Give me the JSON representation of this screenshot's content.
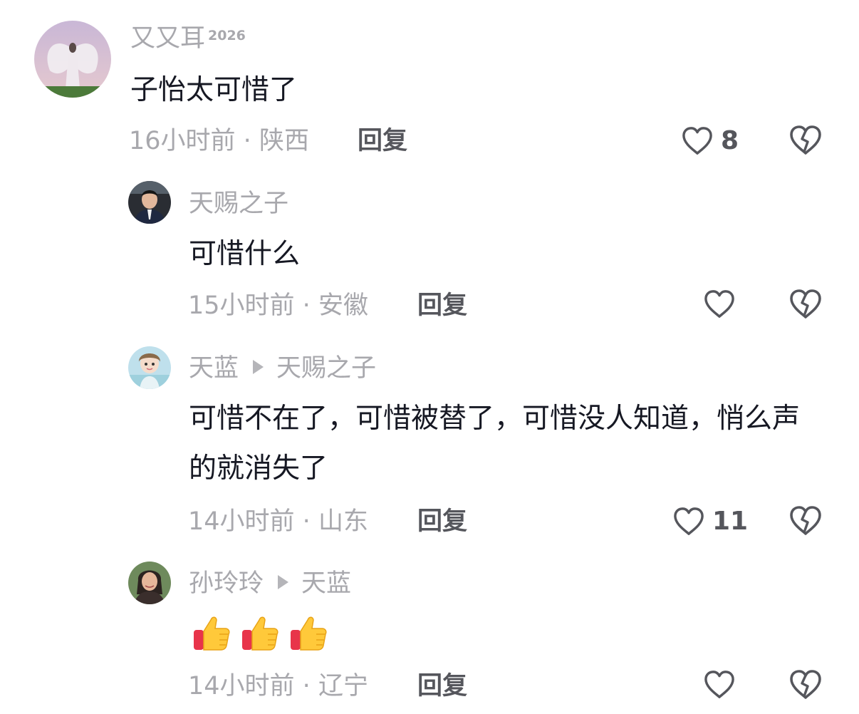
{
  "comments": [
    {
      "user": "又又耳",
      "badge": "2026",
      "reply_to": "",
      "text": "子怡太可惜了",
      "time": "16小时前",
      "location": "陕西",
      "reply_label": "回复",
      "likes": "8"
    },
    {
      "user": "天赐之子",
      "reply_to": "",
      "text": "可惜什么",
      "time": "15小时前",
      "location": "安徽",
      "reply_label": "回复",
      "likes": ""
    },
    {
      "user": "天蓝",
      "reply_to": "天赐之子",
      "text": "可惜不在了，可惜被替了，可惜没人知道，悄么声的就消失了",
      "time": "14小时前",
      "location": "山东",
      "reply_label": "回复",
      "likes": "11"
    },
    {
      "user": "孙玲玲",
      "reply_to": "天蓝",
      "text": "",
      "emoji": [
        "thumbs-up",
        "thumbs-up",
        "thumbs-up"
      ],
      "time": "14小时前",
      "location": "辽宁",
      "reply_label": "回复",
      "likes": ""
    }
  ],
  "separator": " · ",
  "colors": {
    "meta": "#a8a8ad",
    "text": "#161823",
    "icon": "#55565c"
  },
  "icons": {
    "like": "heart-outline-icon",
    "dislike": "broken-heart-icon",
    "reply_arrow": "triangle-right-icon"
  }
}
